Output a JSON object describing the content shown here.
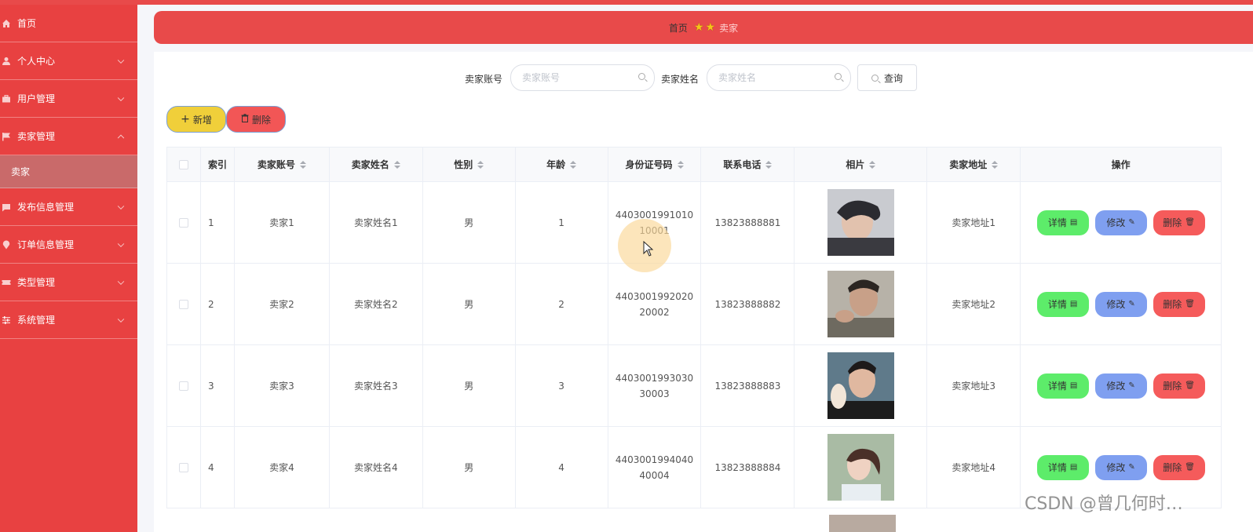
{
  "sidebar": {
    "items": [
      {
        "label": "首页",
        "icon": "home-icon",
        "arrow": false
      },
      {
        "label": "个人中心",
        "icon": "user-icon",
        "arrow": true
      },
      {
        "label": "用户管理",
        "icon": "briefcase-icon",
        "arrow": true
      },
      {
        "label": "卖家管理",
        "icon": "flag-icon",
        "arrow": true,
        "expanded": true
      },
      {
        "label": "发布信息管理",
        "icon": "message-icon",
        "arrow": true
      },
      {
        "label": "订单信息管理",
        "icon": "location-icon",
        "arrow": true
      },
      {
        "label": "类型管理",
        "icon": "ticket-icon",
        "arrow": true
      },
      {
        "label": "系统管理",
        "icon": "settings-icon",
        "arrow": true
      }
    ],
    "sub_item": "卖家"
  },
  "breadcrumb": {
    "home": "首页",
    "current": "卖家"
  },
  "search": {
    "account_label": "卖家账号",
    "account_placeholder": "卖家账号",
    "name_label": "卖家姓名",
    "name_placeholder": "卖家姓名",
    "query_label": "查询"
  },
  "toolbar": {
    "add_label": "新增",
    "delete_label": "删除"
  },
  "table": {
    "headers": {
      "index": "索引",
      "account": "卖家账号",
      "name": "卖家姓名",
      "sex": "性别",
      "age": "年龄",
      "id": "身份证号码",
      "tel": "联系电话",
      "photo": "相片",
      "addr": "卖家地址",
      "op": "操作"
    },
    "rows": [
      {
        "index": "1",
        "account": "卖家1",
        "name": "卖家姓名1",
        "sex": "男",
        "age": "1",
        "id": "440300199101010001",
        "tel": "13823888881",
        "addr": "卖家地址1"
      },
      {
        "index": "2",
        "account": "卖家2",
        "name": "卖家姓名2",
        "sex": "男",
        "age": "2",
        "id": "440300199202020002",
        "tel": "13823888882",
        "addr": "卖家地址2"
      },
      {
        "index": "3",
        "account": "卖家3",
        "name": "卖家姓名3",
        "sex": "男",
        "age": "3",
        "id": "440300199303030003",
        "tel": "13823888883",
        "addr": "卖家地址3"
      },
      {
        "index": "4",
        "account": "卖家4",
        "name": "卖家姓名4",
        "sex": "男",
        "age": "4",
        "id": "440300199404040004",
        "tel": "13823888884",
        "addr": "卖家地址4"
      }
    ],
    "actions": {
      "detail": "详情",
      "edit": "修改",
      "delete": "删除"
    }
  },
  "watermark": "CSDN @曾几何时…"
}
